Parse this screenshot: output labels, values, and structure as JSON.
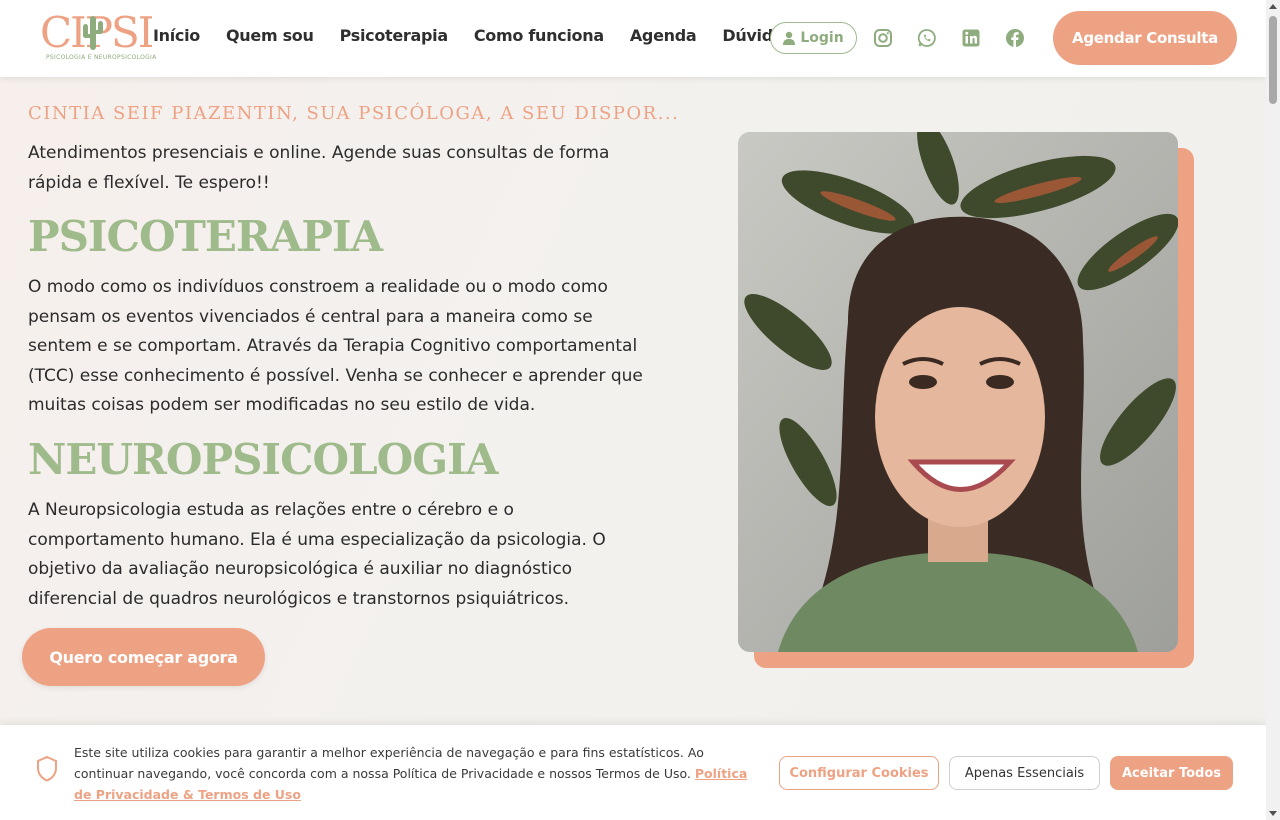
{
  "header": {
    "logo_text": "CIPSI",
    "logo_sub": "PSICOLOGIA E NEUROPSICOLOGIA",
    "nav": [
      "Início",
      "Quem sou",
      "Psicoterapia",
      "Como funciona",
      "Agenda",
      "Dúvidas"
    ],
    "login_label": "Login",
    "social_icons": [
      "instagram-icon",
      "whatsapp-icon",
      "linkedin-icon",
      "facebook-icon"
    ],
    "cta_label": "Agendar Consulta"
  },
  "hero": {
    "eyebrow": "CINTIA SEIF PIAZENTIN, SUA PSICÓLOGA, A SEU DISPOR...",
    "intro": "Atendimentos presenciais e online. Agende suas consultas de forma rápida e flexível. Te espero!!",
    "psico_title": "PSICOTERAPIA",
    "psico_text": "O modo como os indivíduos constroem a realidade ou o modo como pensam os eventos vivenciados é central para a maneira como se sentem e se comportam. Através da Terapia Cognitivo comportamental (TCC) esse conhecimento é possível. Venha se conhecer e aprender que muitas coisas podem ser modificadas no seu estilo de vida.",
    "neuro_title": "NEUROPSICOLOGIA",
    "neuro_text": "A Neuropsicologia estuda as relações entre o cérebro e o comportamento humano. Ela é uma especialização da psicologia. O objetivo da avaliação neuropsicológica é auxiliar no diagnóstico diferencial de quadros neurológicos e transtornos psiquiátricos.",
    "cta_label": "Quero começar agora"
  },
  "cookie": {
    "text": "Este site utiliza cookies para garantir a melhor experiência de navegação e para fins estatísticos. Ao continuar navegando, você concorda com a nossa Política de Privacidade e nossos Termos de Uso.",
    "link": "Política de Privacidade & Termos de Uso",
    "config_label": "Configurar Cookies",
    "essential_label": "Apenas Essenciais",
    "accept_label": "Aceitar Todos"
  },
  "colors": {
    "accent": "#eea284",
    "green": "#9fba8b"
  }
}
